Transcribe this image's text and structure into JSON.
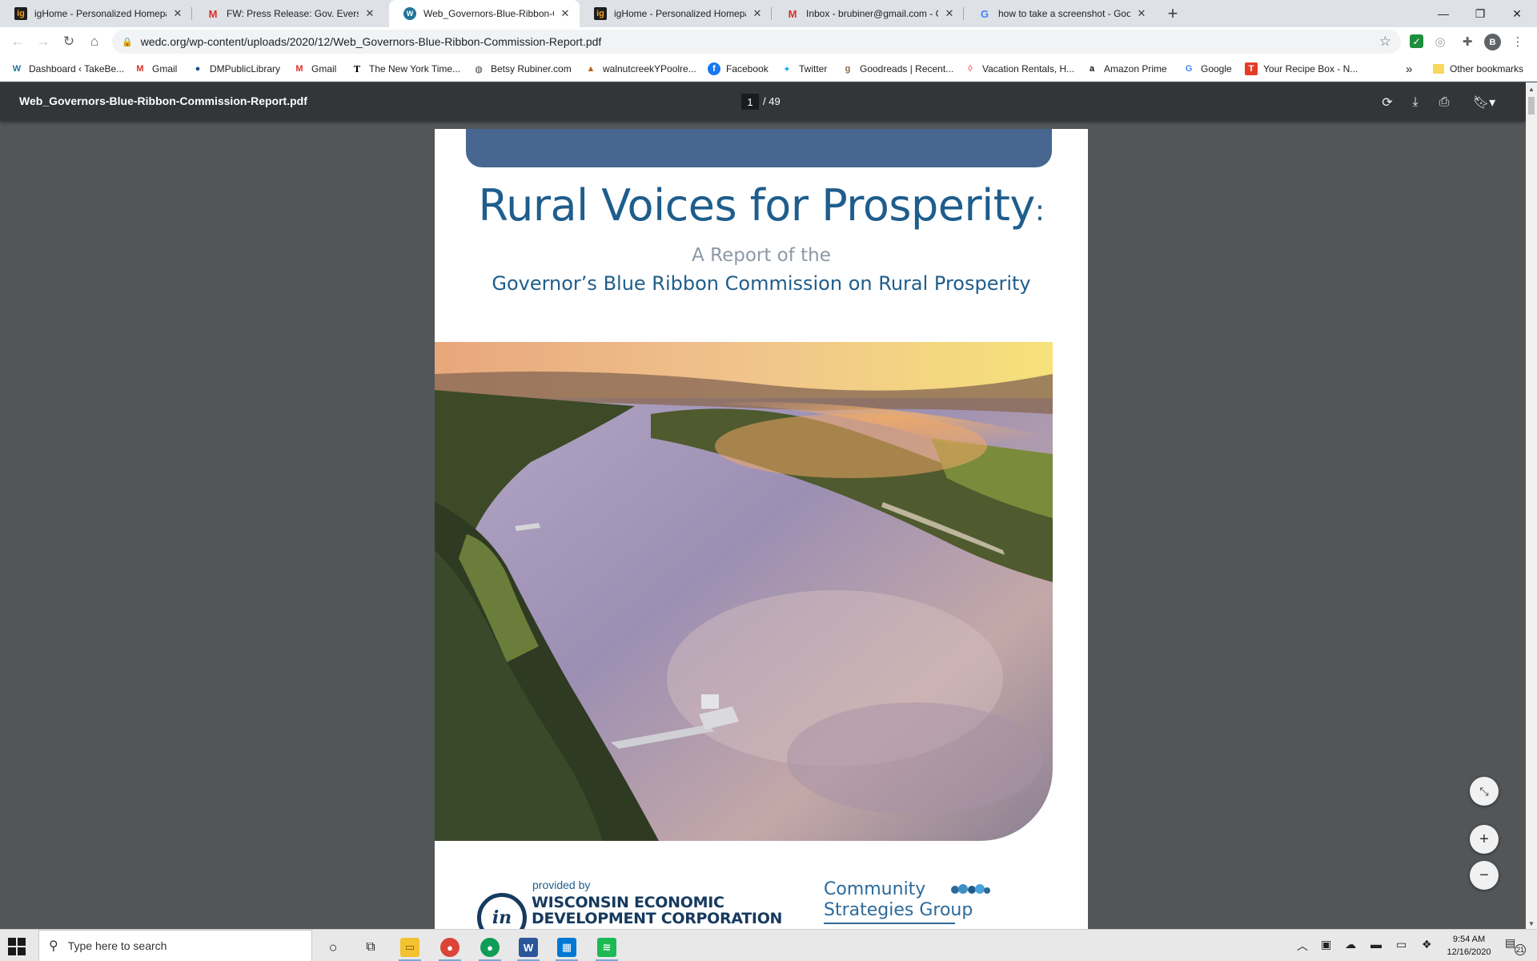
{
  "tabs": [
    {
      "title": "igHome - Personalized Homepag",
      "favicon": "ighome-icon",
      "favicon_text": "ig"
    },
    {
      "title": "FW: Press Release: Gov. Evers An",
      "favicon": "gmail-icon",
      "favicon_text": "M"
    },
    {
      "title": "Web_Governors-Blue-Ribbon-Co",
      "favicon": "wordpress-icon",
      "favicon_text": "W",
      "active": true
    },
    {
      "title": "igHome - Personalized Homepag",
      "favicon": "ighome-icon",
      "favicon_text": "ig"
    },
    {
      "title": "Inbox - brubiner@gmail.com - G",
      "favicon": "gmail-icon",
      "favicon_text": "M"
    },
    {
      "title": "how to take a screenshot - Goog",
      "favicon": "google-icon",
      "favicon_text": "G"
    }
  ],
  "address_bar": {
    "url": "wedc.org/wp-content/uploads/2020/12/Web_Governors-Blue-Ribbon-Commission-Report.pdf"
  },
  "profile_initial": "B",
  "bookmarks": [
    {
      "label": "Dashboard ‹ TakeBe...",
      "icon": "wordpress-icon",
      "glyph": "W",
      "color": "#21759b"
    },
    {
      "label": "Gmail",
      "icon": "gmail-icon",
      "glyph": "M",
      "color": "#d93025"
    },
    {
      "label": "DMPublicLibrary",
      "icon": "library-icon",
      "glyph": "●",
      "color": "#1a4e8a"
    },
    {
      "label": "Gmail",
      "icon": "gmail-icon",
      "glyph": "M",
      "color": "#d93025"
    },
    {
      "label": "The New York Time...",
      "icon": "nyt-icon",
      "glyph": "T",
      "color": "#000000"
    },
    {
      "label": "Betsy Rubiner.com",
      "icon": "globe-icon",
      "glyph": "◍",
      "color": "#444444"
    },
    {
      "label": "walnutcreekYPoolre...",
      "icon": "pool-icon",
      "glyph": "▲",
      "color": "#b5651d"
    },
    {
      "label": "Facebook",
      "icon": "facebook-icon",
      "glyph": "f",
      "color": "#1877f2"
    },
    {
      "label": "Twitter",
      "icon": "twitter-icon",
      "glyph": "t",
      "color": "#1da1f2"
    },
    {
      "label": "Goodreads | Recent...",
      "icon": "goodreads-icon",
      "glyph": "g",
      "color": "#8a6a3f"
    },
    {
      "label": "Vacation Rentals, H...",
      "icon": "airbnb-icon",
      "glyph": "◊",
      "color": "#ff5a5f"
    },
    {
      "label": "Amazon Prime",
      "icon": "amazon-icon",
      "glyph": "a",
      "color": "#111111"
    },
    {
      "label": "Google",
      "icon": "google-icon",
      "glyph": "G",
      "color": "#4285f4"
    },
    {
      "label": "Your Recipe Box - N...",
      "icon": "nyt-cooking-icon",
      "glyph": "T",
      "color": "#e33d26"
    }
  ],
  "bookmarks_overflow": "»",
  "other_bookmarks": "Other bookmarks",
  "pdf": {
    "filename": "Web_Governors-Blue-Ribbon-Commission-Report.pdf",
    "current_page": "1",
    "total_pages": "/ 49"
  },
  "document": {
    "title": "Rural Voices for Prosperity",
    "title_colon": ":",
    "subtitle": "A Report of the",
    "subtitle2": "Governor’s Blue Ribbon Commission on Rural Prosperity",
    "provided_by": "provided by",
    "wedc_line1": "WISCONSIN ECONOMIC",
    "wedc_line2": "DEVELOPMENT CORPORATION",
    "wedc_logo_text": "in",
    "csg_line1": "Community",
    "csg_line2": "Strategies Group"
  },
  "taskbar": {
    "search_placeholder": "Type here to search",
    "time": "9:54 AM",
    "date": "12/16/2020",
    "notification_count": "21"
  }
}
